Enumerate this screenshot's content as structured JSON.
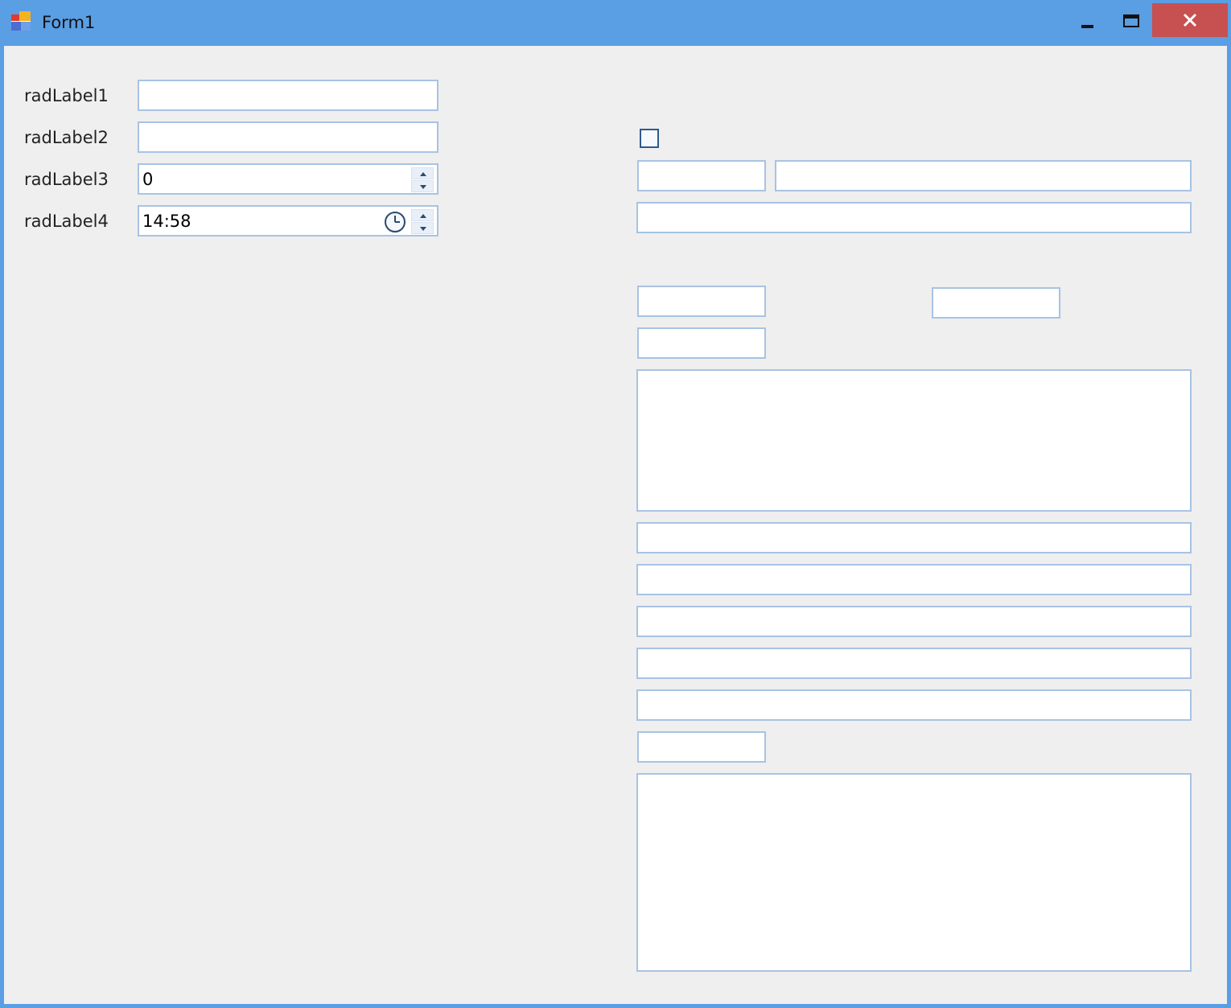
{
  "window": {
    "title": "Form1",
    "colors": {
      "titlebar": "#5a9ee3",
      "close": "#c75050",
      "client": "#efefef",
      "border": "#a8c3e3"
    },
    "controls": {
      "minimize_icon": "minimize-icon",
      "maximize_icon": "maximize-icon",
      "close_icon": "close-icon"
    }
  },
  "form": {
    "labels": [
      "radLabel1",
      "radLabel2",
      "radLabel3",
      "radLabel4"
    ],
    "textbox1_value": "",
    "textbox2_value": "",
    "spin_value": "0",
    "time_value": "14:58"
  },
  "right_panel": {
    "checkbox_checked": false
  }
}
